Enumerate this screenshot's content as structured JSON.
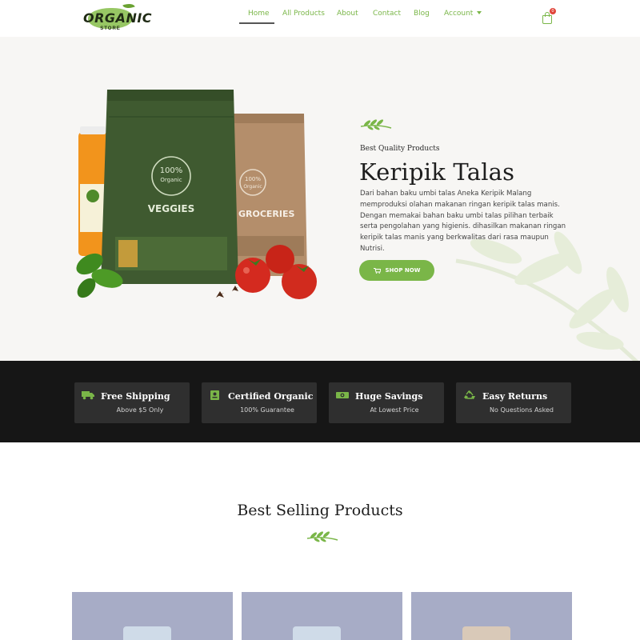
{
  "brand": {
    "name": "ORGANIC",
    "sub": "STORE"
  },
  "nav": {
    "items": [
      {
        "label": "Home"
      },
      {
        "label": "All Products"
      },
      {
        "label": "About"
      },
      {
        "label": "Contact"
      },
      {
        "label": "Blog"
      },
      {
        "label": "Account"
      }
    ],
    "active": "Home"
  },
  "cart": {
    "count": "0"
  },
  "hero": {
    "kicker": "Best Quality Products",
    "title": "Keripik Talas",
    "description": "Dari bahan baku umbi talas Aneka Keripik Malang memproduksi olahan makanan ringan keripik talas manis. Dengan memakai bahan baku umbi talas pilihan terbaik serta pengolahan yang higienis. dihasilkan makanan ringan keripik talas manis yang berkwalitas dari rasa maupun Nutrisi.",
    "button": "SHOP NOW",
    "packaging": {
      "badge_top": "100%",
      "badge_bottom": "Organic",
      "bag1_label": "VEGGIES",
      "bag2_label": "GROCERIES"
    }
  },
  "features": [
    {
      "icon": "truck-icon",
      "title": "Free Shipping",
      "subtitle": "Above $5 Only"
    },
    {
      "icon": "certificate-icon",
      "title": "Certified Organic",
      "subtitle": "100% Guarantee"
    },
    {
      "icon": "money-icon",
      "title": "Huge Savings",
      "subtitle": "At Lowest Price"
    },
    {
      "icon": "recycle-icon",
      "title": "Easy Returns",
      "subtitle": "No Questions Asked"
    }
  ],
  "best_selling": {
    "title": "Best Selling Products"
  },
  "colors": {
    "accent": "#7ab648",
    "dark": "#161616",
    "card": "#a7acc6",
    "badge": "#e0453a"
  }
}
